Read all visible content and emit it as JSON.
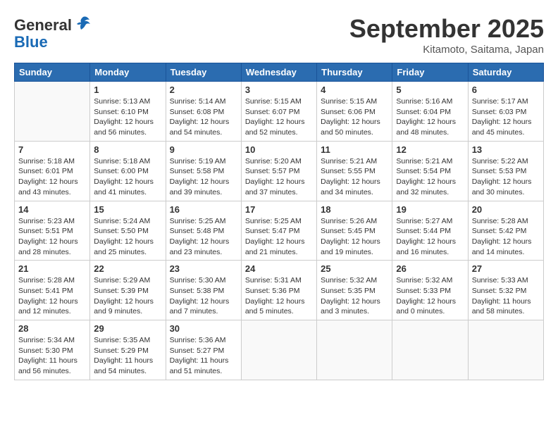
{
  "logo": {
    "general": "General",
    "blue": "Blue"
  },
  "title": "September 2025",
  "location": "Kitamoto, Saitama, Japan",
  "days_of_week": [
    "Sunday",
    "Monday",
    "Tuesday",
    "Wednesday",
    "Thursday",
    "Friday",
    "Saturday"
  ],
  "weeks": [
    [
      null,
      {
        "day": 1,
        "sunrise": "5:13 AM",
        "sunset": "6:10 PM",
        "daylight": "12 hours and 56 minutes."
      },
      {
        "day": 2,
        "sunrise": "5:14 AM",
        "sunset": "6:08 PM",
        "daylight": "12 hours and 54 minutes."
      },
      {
        "day": 3,
        "sunrise": "5:15 AM",
        "sunset": "6:07 PM",
        "daylight": "12 hours and 52 minutes."
      },
      {
        "day": 4,
        "sunrise": "5:15 AM",
        "sunset": "6:06 PM",
        "daylight": "12 hours and 50 minutes."
      },
      {
        "day": 5,
        "sunrise": "5:16 AM",
        "sunset": "6:04 PM",
        "daylight": "12 hours and 48 minutes."
      },
      {
        "day": 6,
        "sunrise": "5:17 AM",
        "sunset": "6:03 PM",
        "daylight": "12 hours and 45 minutes."
      }
    ],
    [
      {
        "day": 7,
        "sunrise": "5:18 AM",
        "sunset": "6:01 PM",
        "daylight": "12 hours and 43 minutes."
      },
      {
        "day": 8,
        "sunrise": "5:18 AM",
        "sunset": "6:00 PM",
        "daylight": "12 hours and 41 minutes."
      },
      {
        "day": 9,
        "sunrise": "5:19 AM",
        "sunset": "5:58 PM",
        "daylight": "12 hours and 39 minutes."
      },
      {
        "day": 10,
        "sunrise": "5:20 AM",
        "sunset": "5:57 PM",
        "daylight": "12 hours and 37 minutes."
      },
      {
        "day": 11,
        "sunrise": "5:21 AM",
        "sunset": "5:55 PM",
        "daylight": "12 hours and 34 minutes."
      },
      {
        "day": 12,
        "sunrise": "5:21 AM",
        "sunset": "5:54 PM",
        "daylight": "12 hours and 32 minutes."
      },
      {
        "day": 13,
        "sunrise": "5:22 AM",
        "sunset": "5:53 PM",
        "daylight": "12 hours and 30 minutes."
      }
    ],
    [
      {
        "day": 14,
        "sunrise": "5:23 AM",
        "sunset": "5:51 PM",
        "daylight": "12 hours and 28 minutes."
      },
      {
        "day": 15,
        "sunrise": "5:24 AM",
        "sunset": "5:50 PM",
        "daylight": "12 hours and 25 minutes."
      },
      {
        "day": 16,
        "sunrise": "5:25 AM",
        "sunset": "5:48 PM",
        "daylight": "12 hours and 23 minutes."
      },
      {
        "day": 17,
        "sunrise": "5:25 AM",
        "sunset": "5:47 PM",
        "daylight": "12 hours and 21 minutes."
      },
      {
        "day": 18,
        "sunrise": "5:26 AM",
        "sunset": "5:45 PM",
        "daylight": "12 hours and 19 minutes."
      },
      {
        "day": 19,
        "sunrise": "5:27 AM",
        "sunset": "5:44 PM",
        "daylight": "12 hours and 16 minutes."
      },
      {
        "day": 20,
        "sunrise": "5:28 AM",
        "sunset": "5:42 PM",
        "daylight": "12 hours and 14 minutes."
      }
    ],
    [
      {
        "day": 21,
        "sunrise": "5:28 AM",
        "sunset": "5:41 PM",
        "daylight": "12 hours and 12 minutes."
      },
      {
        "day": 22,
        "sunrise": "5:29 AM",
        "sunset": "5:39 PM",
        "daylight": "12 hours and 9 minutes."
      },
      {
        "day": 23,
        "sunrise": "5:30 AM",
        "sunset": "5:38 PM",
        "daylight": "12 hours and 7 minutes."
      },
      {
        "day": 24,
        "sunrise": "5:31 AM",
        "sunset": "5:36 PM",
        "daylight": "12 hours and 5 minutes."
      },
      {
        "day": 25,
        "sunrise": "5:32 AM",
        "sunset": "5:35 PM",
        "daylight": "12 hours and 3 minutes."
      },
      {
        "day": 26,
        "sunrise": "5:32 AM",
        "sunset": "5:33 PM",
        "daylight": "12 hours and 0 minutes."
      },
      {
        "day": 27,
        "sunrise": "5:33 AM",
        "sunset": "5:32 PM",
        "daylight": "11 hours and 58 minutes."
      }
    ],
    [
      {
        "day": 28,
        "sunrise": "5:34 AM",
        "sunset": "5:30 PM",
        "daylight": "11 hours and 56 minutes."
      },
      {
        "day": 29,
        "sunrise": "5:35 AM",
        "sunset": "5:29 PM",
        "daylight": "11 hours and 54 minutes."
      },
      {
        "day": 30,
        "sunrise": "5:36 AM",
        "sunset": "5:27 PM",
        "daylight": "11 hours and 51 minutes."
      },
      null,
      null,
      null,
      null
    ]
  ]
}
